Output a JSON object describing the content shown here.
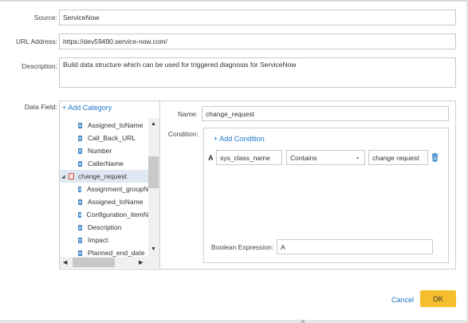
{
  "form": {
    "source_label": "Source:",
    "source_value": "ServiceNow",
    "url_label": "URL Address:",
    "url_value": "https://dev59490.service-now.com/",
    "description_label": "Description:",
    "description_value": "Build data structure which can be used for triggered diagnosis for ServiceNow",
    "data_field_label": "Data Field:",
    "add_category": "+ Add Category"
  },
  "tree": {
    "items": [
      {
        "label": "Assigned_toName",
        "type": "field"
      },
      {
        "label": "Call_Back_URL",
        "type": "field"
      },
      {
        "label": "Number",
        "type": "field"
      },
      {
        "label": "CallerName",
        "type": "field"
      },
      {
        "label": "change_request",
        "type": "category",
        "expanded": true,
        "selected": true
      },
      {
        "label": "Assignment_groupN",
        "type": "field"
      },
      {
        "label": "Assigned_toName",
        "type": "field"
      },
      {
        "label": "Configuration_itemN",
        "type": "field"
      },
      {
        "label": "Description",
        "type": "field"
      },
      {
        "label": "Impact",
        "type": "field"
      },
      {
        "label": "Planned_end_date",
        "type": "field"
      }
    ]
  },
  "detail": {
    "name_label": "Name:",
    "name_value": "change_request",
    "condition_label": "Condition:",
    "add_condition": "+ Add Condition",
    "condition_letter": "A",
    "condition_field": "sys_class_name",
    "condition_operator": "Contains",
    "condition_value": "change request",
    "boolean_label": "Boolean Expression:",
    "boolean_value": "A"
  },
  "buttons": {
    "cancel": "Cancel",
    "ok": "OK"
  },
  "colors": {
    "link": "#1f78c8",
    "ok_button": "#f5be2e",
    "selected_row": "#dfe8f2"
  }
}
